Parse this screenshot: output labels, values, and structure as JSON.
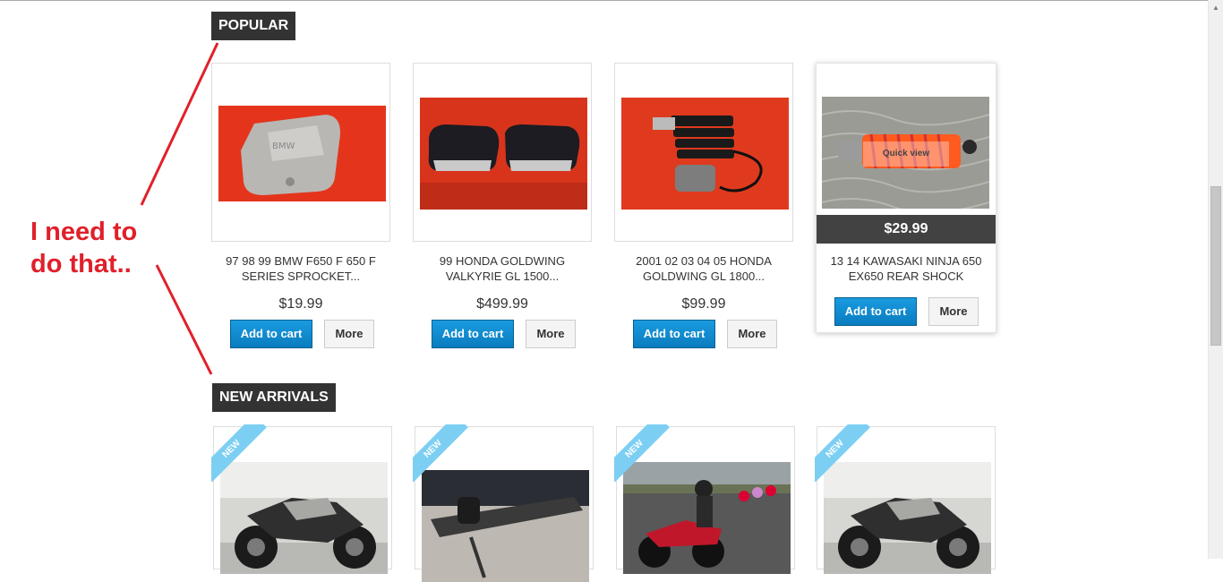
{
  "sections": {
    "popular_title": "POPULAR",
    "new_title": "NEW ARRIVALS"
  },
  "popular": [
    {
      "name": "97 98 99 BMW F650 F 650 F SERIES SPROCKET...",
      "price": "$19.99",
      "cart": "Add to cart",
      "more": "More"
    },
    {
      "name": "99 HONDA GOLDWING VALKYRIE GL 1500...",
      "price": "$499.99",
      "cart": "Add to cart",
      "more": "More"
    },
    {
      "name": "2001 02 03 04 05 HONDA GOLDWING GL 1800...",
      "price": "$99.99",
      "cart": "Add to cart",
      "more": "More"
    },
    {
      "name": "13 14 KAWASAKI NINJA 650 EX650 REAR SHOCK",
      "price": "$29.99",
      "cart": "Add to cart",
      "more": "More",
      "quick_view": "Quick view"
    }
  ],
  "new_arrivals": [
    {
      "badge": "NEW"
    },
    {
      "badge": "NEW"
    },
    {
      "badge": "NEW"
    },
    {
      "badge": "NEW"
    }
  ],
  "annotation": {
    "line1": "I need to",
    "line2": "do that.."
  },
  "colors": {
    "accent": "#0c8fd0",
    "annotation": "#e0202a",
    "ribbon": "#7ccff2"
  },
  "icons": {
    "scroll_up": "triangle-up-icon"
  }
}
